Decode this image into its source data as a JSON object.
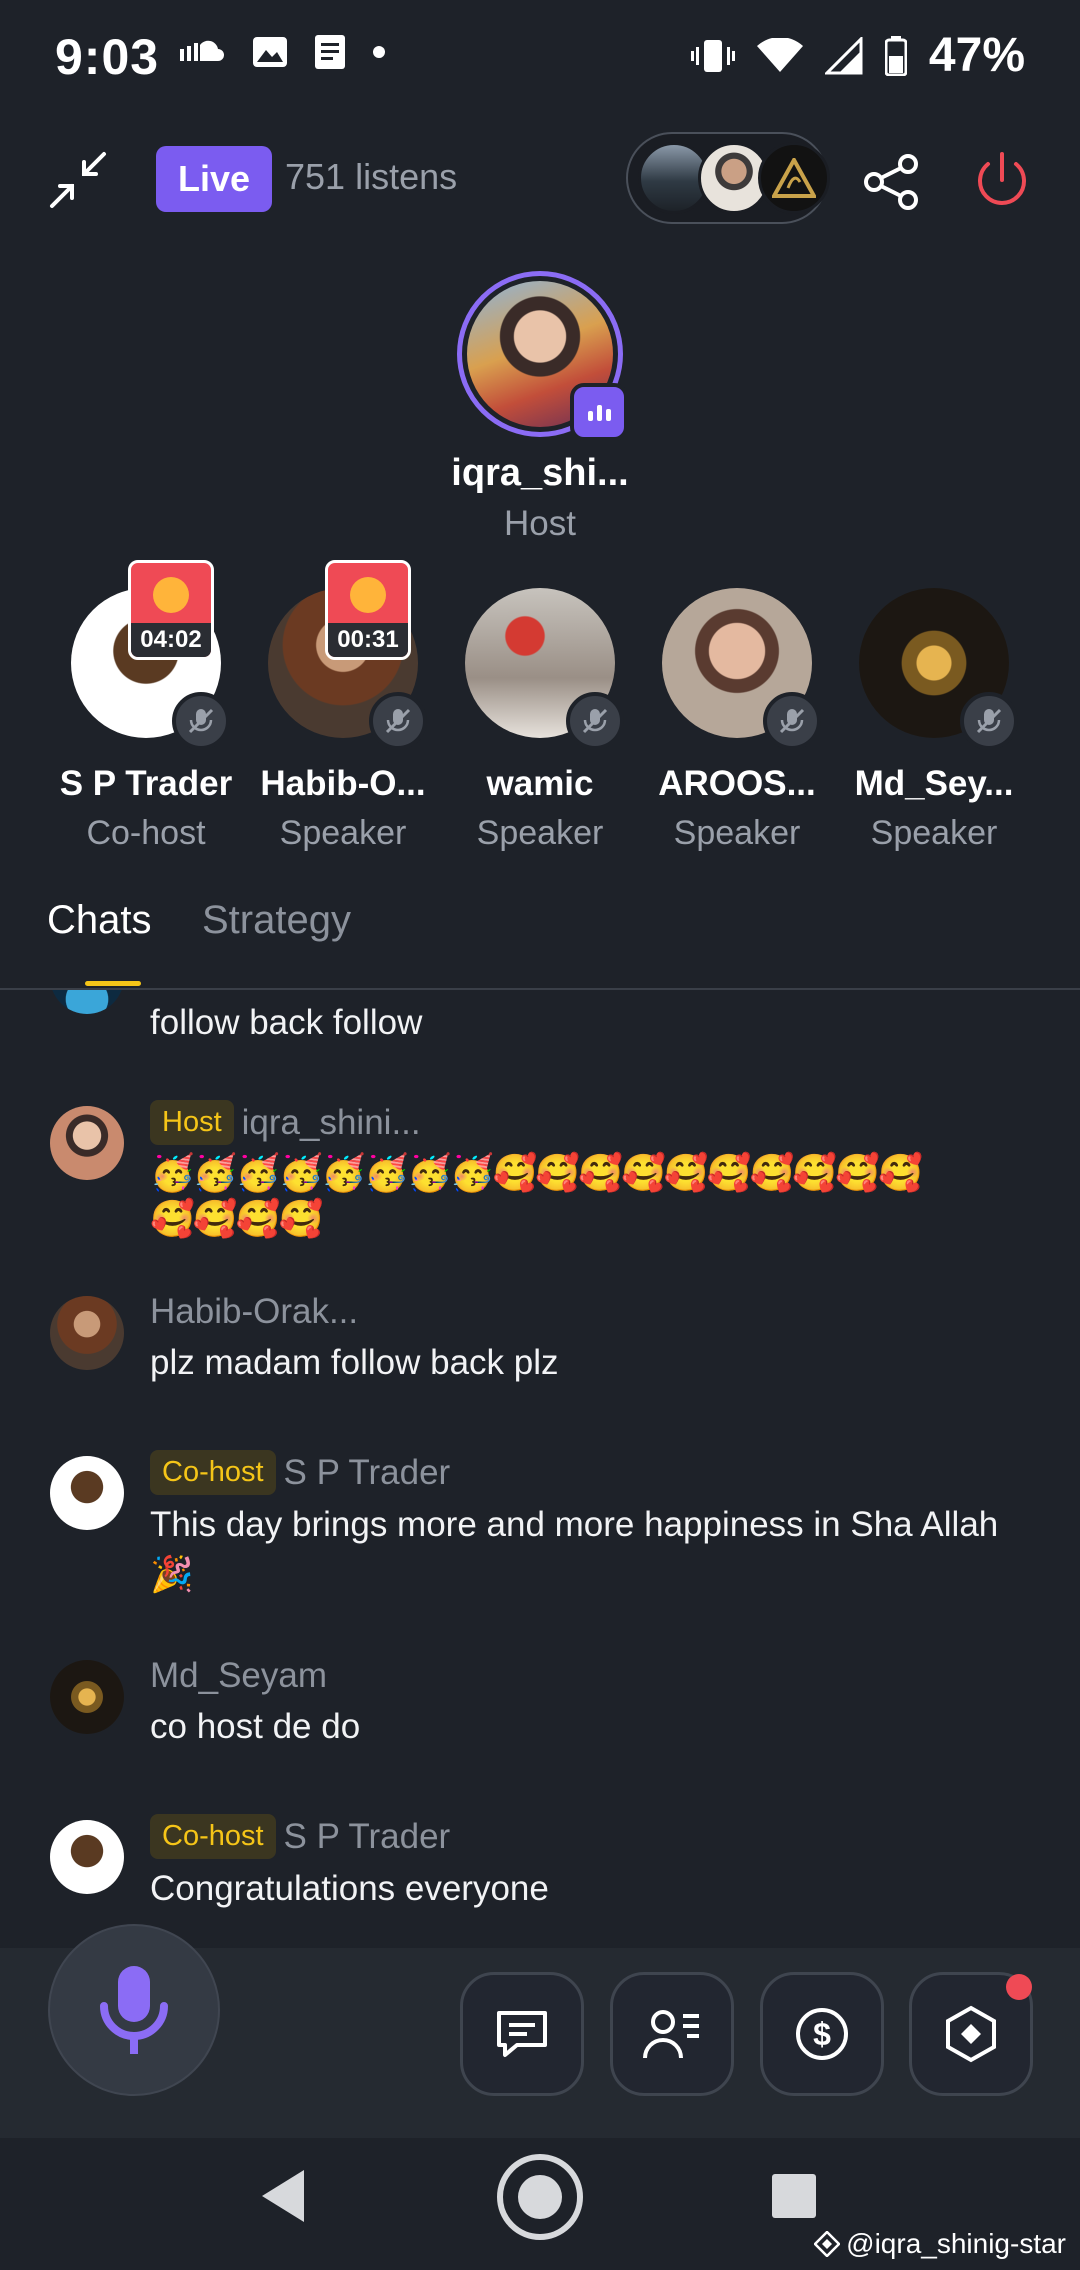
{
  "status_bar": {
    "time": "9:03",
    "battery": "47%"
  },
  "header": {
    "live_label": "Live",
    "listens": "751 listens"
  },
  "host": {
    "name": "iqra_shi...",
    "role": "Host"
  },
  "speakers": [
    {
      "name": "S P Trader",
      "role": "Co-host",
      "gift_timer": "04:02"
    },
    {
      "name": "Habib-O...",
      "role": "Speaker",
      "gift_timer": "00:31"
    },
    {
      "name": "wamic",
      "role": "Speaker"
    },
    {
      "name": "AROOS...",
      "role": "Speaker"
    },
    {
      "name": "Md_Sey...",
      "role": "Speaker"
    }
  ],
  "tabs": [
    {
      "label": "Chats"
    },
    {
      "label": "Strategy"
    }
  ],
  "chat": {
    "partial": {
      "text": "follow back follow"
    },
    "messages": [
      {
        "tag": "Host",
        "user": "iqra_shini...",
        "line1": "🥳🥳🥳🥳🥳🥳🥳🥳🥰🥰🥰🥰🥰🥰🥰🥰🥰🥰",
        "line2": "🥰🥰🥰🥰"
      },
      {
        "user": "Habib-Orak...",
        "text": "plz madam follow back plz"
      },
      {
        "tag": "Co-host",
        "user": "S P Trader",
        "text": "This day brings more and more happiness in Sha Allah 🎉"
      },
      {
        "user": "Md_Seyam",
        "text": "co host de do"
      },
      {
        "tag": "Co-host",
        "user": "S P Trader",
        "text": "Congratulations everyone"
      }
    ]
  },
  "watermark": "@iqra_shinig-star",
  "colors": {
    "accent": "#7b5cf0",
    "background": "#1e2229",
    "tag_text": "#f5c518",
    "end_button": "#ef4a55"
  },
  "icons": [
    "minimize-icon",
    "share-icon",
    "power-icon",
    "mic-icon",
    "chat-icon",
    "participants-icon",
    "tip-icon",
    "hexagon-icon",
    "mute-icon"
  ]
}
